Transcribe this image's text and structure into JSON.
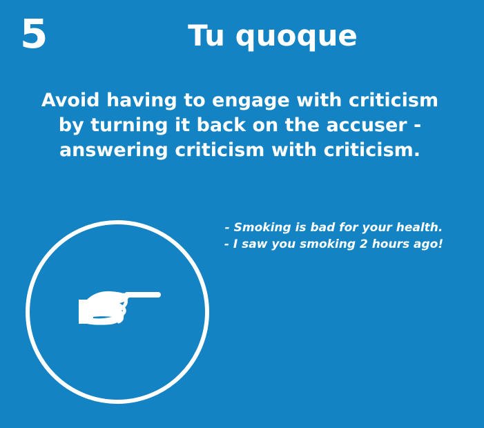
{
  "card": {
    "number": "5",
    "title": "Tu quoque",
    "description": "Avoid having to engage with criticism by turning it back on the accuser - answering criticism with criticism.",
    "example_lines": [
      "- Smoking is bad for your health.",
      "- I saw you smoking 2 hours ago!"
    ],
    "icon": "pointing-hand-icon",
    "colors": {
      "background": "#1383c3",
      "foreground": "#ffffff"
    }
  }
}
